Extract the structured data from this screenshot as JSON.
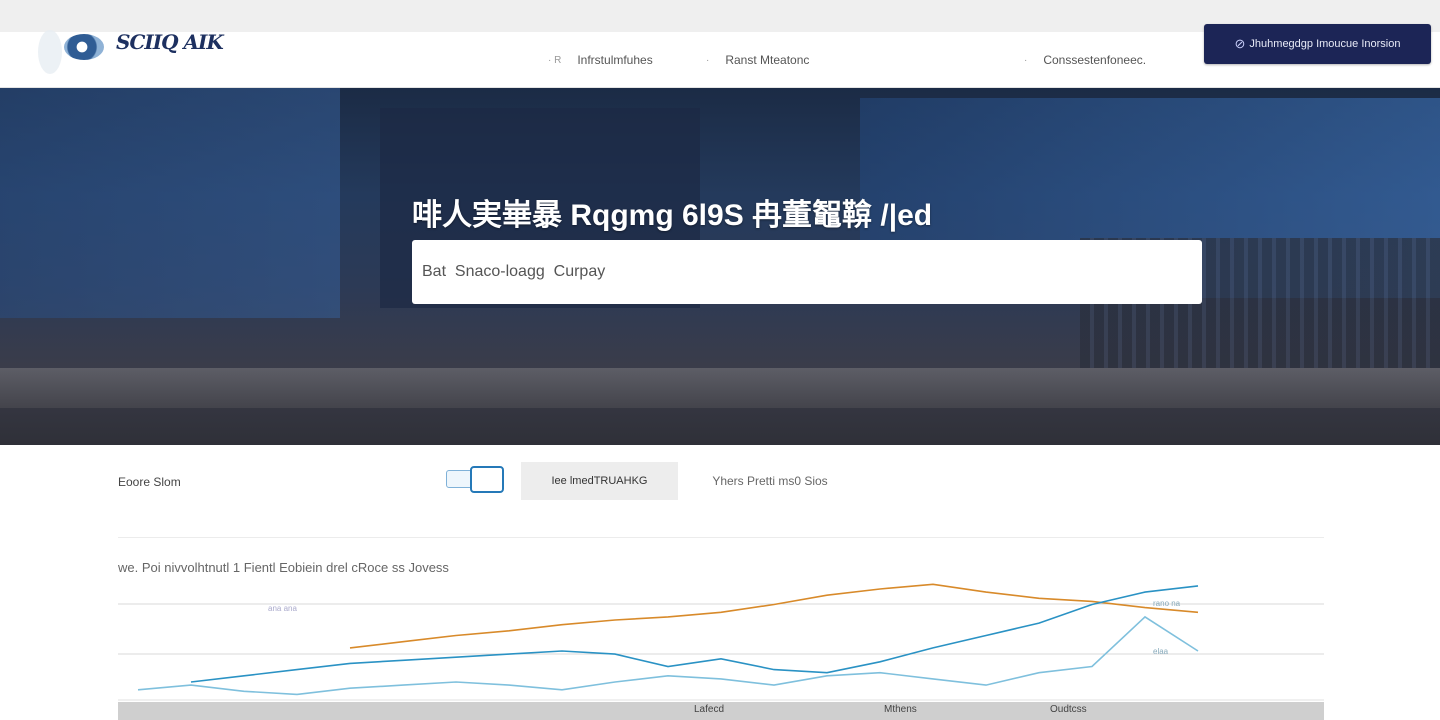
{
  "logo": {
    "text": "SCIIQ AIK"
  },
  "nav": {
    "links": [
      {
        "label": "Infrstulmfuhes",
        "bullet": "·  R"
      },
      {
        "label": "Ranst Mteatonc",
        "bullet": "·"
      },
      {
        "label": "Conssestenfoneec.",
        "bullet": "·"
      }
    ],
    "cta_label": "Jhuhmegdgp Imoucue Inorsion"
  },
  "hero": {
    "title": "啡人実崋暴 Rqgmg 6l9S 冉董鼅鞥 /|ed",
    "search_value": "Bat  Snaco-loagg  Curpay"
  },
  "controls": {
    "label": "Eoore Slom",
    "segment_active": "Iee lmedTRUAHKG",
    "segment_other": "Yhers Pretti ms0 Sios"
  },
  "chart_data": {
    "type": "line",
    "title": "",
    "caption": "we.  Poi nivvolhtnutl 1 Fientl Eobiein drel cRoce  ss Jovess",
    "xlabel": "",
    "ylabel": "",
    "grid": true,
    "x_tick_labels": [
      "Lafecd",
      "Mthens",
      "Oudtcss"
    ],
    "series_annotations": [
      "ana ana",
      "rano na",
      "elaa"
    ],
    "x": [
      0,
      5,
      10,
      15,
      20,
      25,
      30,
      35,
      40,
      45,
      50,
      55,
      60,
      65,
      70,
      75,
      80,
      85,
      90,
      95,
      100
    ],
    "ylim": [
      0,
      100
    ],
    "series": [
      {
        "color": "#d88a2a",
        "values": [
          null,
          null,
          null,
          null,
          42,
          46,
          50,
          53,
          57,
          60,
          62,
          65,
          70,
          76,
          80,
          83,
          78,
          74,
          72,
          68,
          65
        ]
      },
      {
        "color": "#2a92c4",
        "values": [
          null,
          20,
          24,
          28,
          32,
          34,
          36,
          38,
          40,
          38,
          30,
          35,
          28,
          26,
          33,
          42,
          50,
          58,
          70,
          78,
          82
        ]
      },
      {
        "color": "#7fc0dd",
        "values": [
          15,
          18,
          14,
          12,
          16,
          18,
          20,
          18,
          15,
          20,
          24,
          22,
          18,
          24,
          26,
          22,
          18,
          26,
          30,
          62,
          40
        ]
      }
    ]
  }
}
